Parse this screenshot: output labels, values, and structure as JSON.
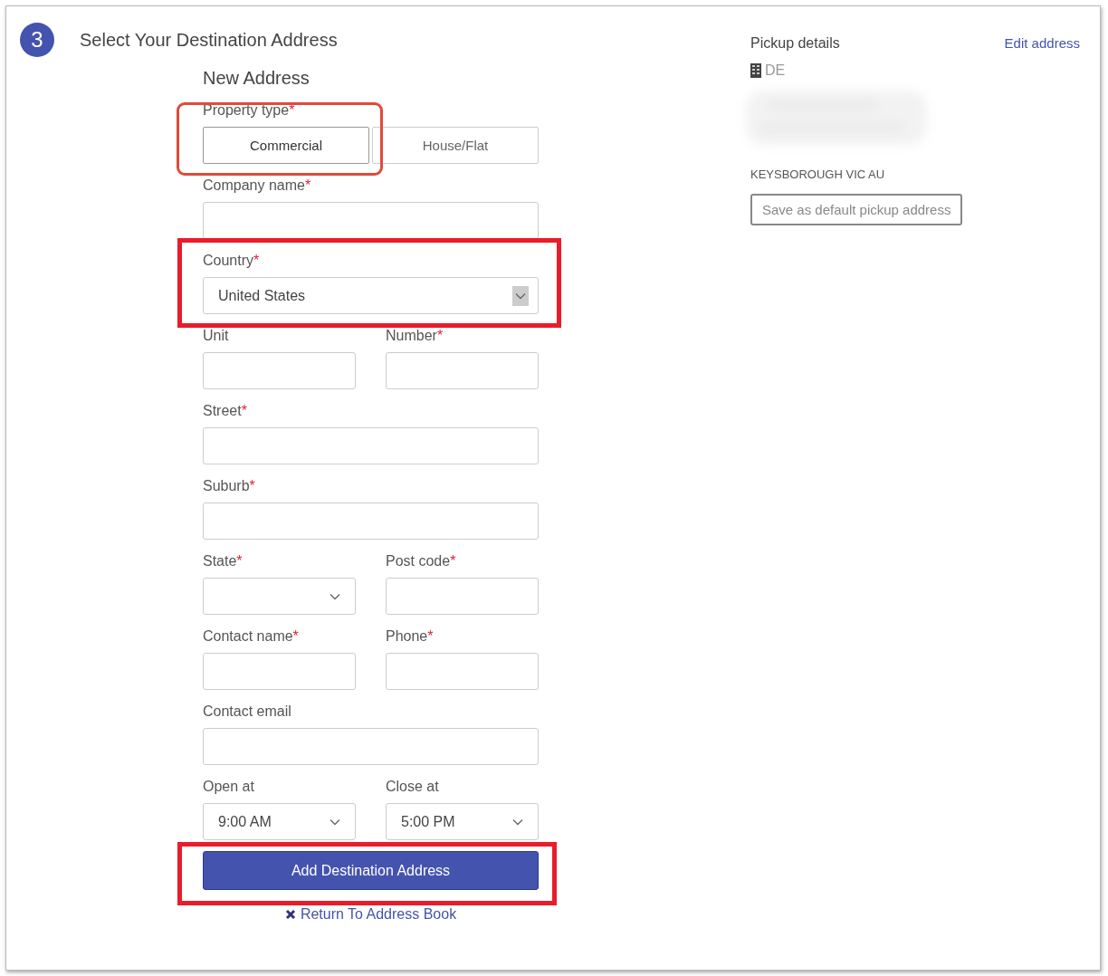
{
  "step": {
    "number": "3",
    "title": "Select Your Destination Address"
  },
  "form": {
    "heading": "New Address",
    "rows": [
      {
        "fields": [
          {
            "kind": "toggle",
            "label": "Property type",
            "mark": "*",
            "highlight": {
              "kind": "rounded"
            },
            "options": [
              {
                "label": "Commercial",
                "selected": true
              },
              {
                "label": "House/Flat",
                "selected": false
              }
            ]
          }
        ]
      },
      {
        "fields": [
          {
            "kind": "text",
            "label": "Company name",
            "mark": "*"
          }
        ]
      },
      {
        "fields": [
          {
            "kind": "select",
            "label": "Country",
            "mark": "*",
            "value": "United States",
            "arrow_boxed": true,
            "highlight": {
              "kind": "box"
            }
          }
        ]
      },
      {
        "fields": [
          {
            "kind": "text",
            "label": "Unit"
          },
          {
            "kind": "text",
            "label": "Number",
            "mark": "*"
          }
        ]
      },
      {
        "fields": [
          {
            "kind": "text",
            "label": "Street",
            "mark": "*"
          }
        ]
      },
      {
        "fields": [
          {
            "kind": "text",
            "label": "Suburb",
            "mark": "*"
          }
        ]
      },
      {
        "fields": [
          {
            "kind": "select",
            "label": "State",
            "mark": "*",
            "arrow_boxed": false
          },
          {
            "kind": "text",
            "label": "Post code",
            "mark": "*"
          }
        ]
      },
      {
        "fields": [
          {
            "kind": "text",
            "label": "Contact name",
            "mark": "*"
          },
          {
            "kind": "text",
            "label": "Phone",
            "mark": "*"
          }
        ]
      },
      {
        "fields": [
          {
            "kind": "text",
            "label": "Contact email"
          }
        ]
      },
      {
        "fields": [
          {
            "kind": "select",
            "label": "Open at",
            "value": "9:00 AM",
            "arrow_boxed": false
          },
          {
            "kind": "select",
            "label": "Close at",
            "value": "5:00 PM",
            "arrow_boxed": false
          }
        ]
      }
    ],
    "submit": {
      "label": "Add Destination Address",
      "highlight": {
        "kind": "box"
      }
    },
    "return_link": {
      "label": "Return To Address Book"
    }
  },
  "pickup": {
    "title": "Pickup details",
    "edit_link": "Edit address",
    "company_name": "DE",
    "redacted": true,
    "locality": "KEYSBOROUGH VIC AU",
    "save_default_button": "Save as default pickup address"
  }
}
